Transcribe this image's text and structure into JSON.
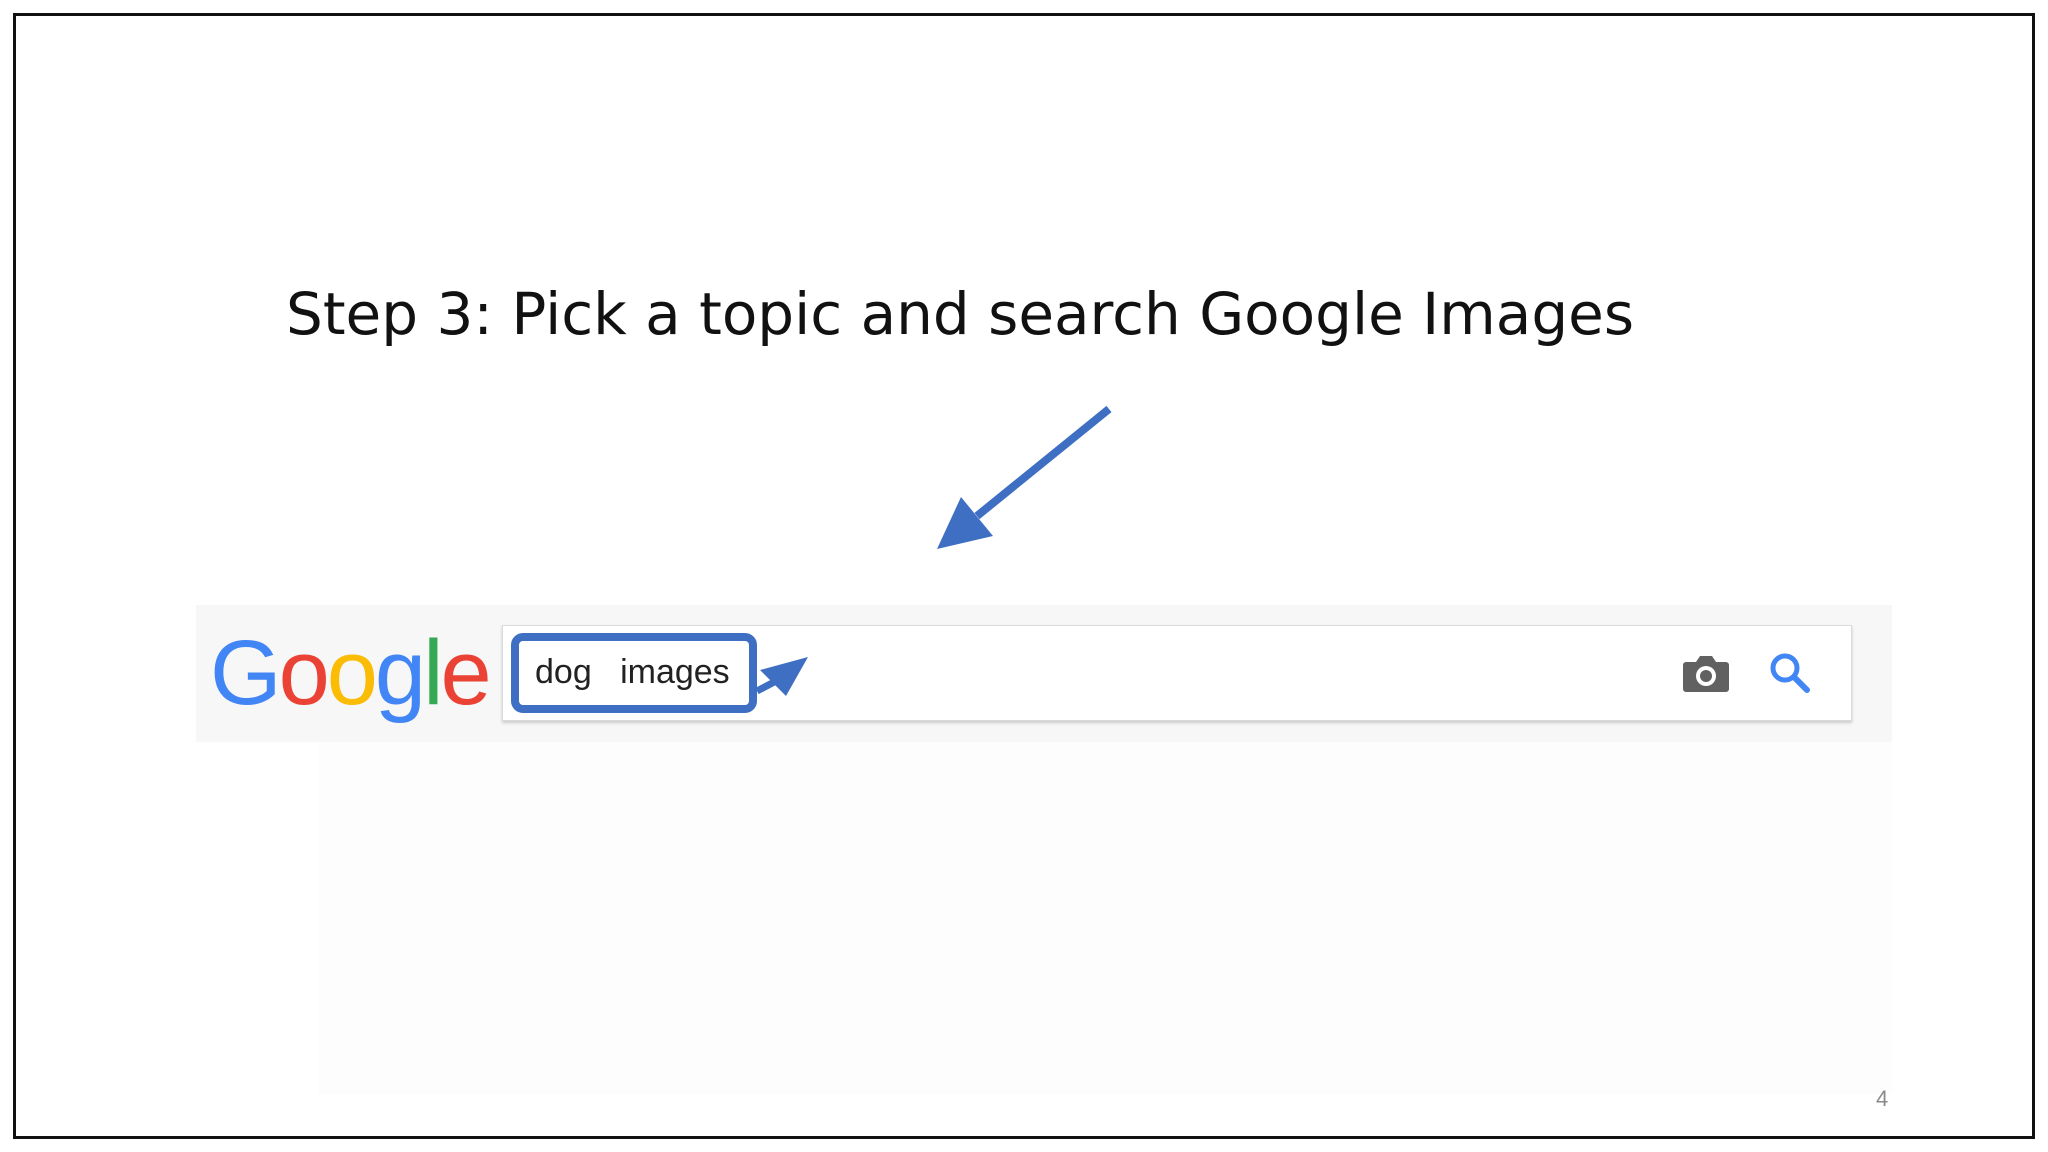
{
  "slide": {
    "title": "Step 3: Pick a topic and search Google Images",
    "page_number": "4"
  },
  "google": {
    "logo_letters": [
      {
        "char": "G",
        "color": "#4285F4"
      },
      {
        "char": "o",
        "color": "#EA4335"
      },
      {
        "char": "o",
        "color": "#FBBC05"
      },
      {
        "char": "g",
        "color": "#4285F4"
      },
      {
        "char": "l",
        "color": "#34A853"
      },
      {
        "char": "e",
        "color": "#EA4335"
      }
    ],
    "search": {
      "query": "dog   images"
    },
    "icons": {
      "camera": "camera-icon",
      "search": "search-icon"
    }
  },
  "colors": {
    "annotation": "#3f6fc3",
    "camera_icon": "#616161",
    "search_icon": "#4285F4"
  }
}
